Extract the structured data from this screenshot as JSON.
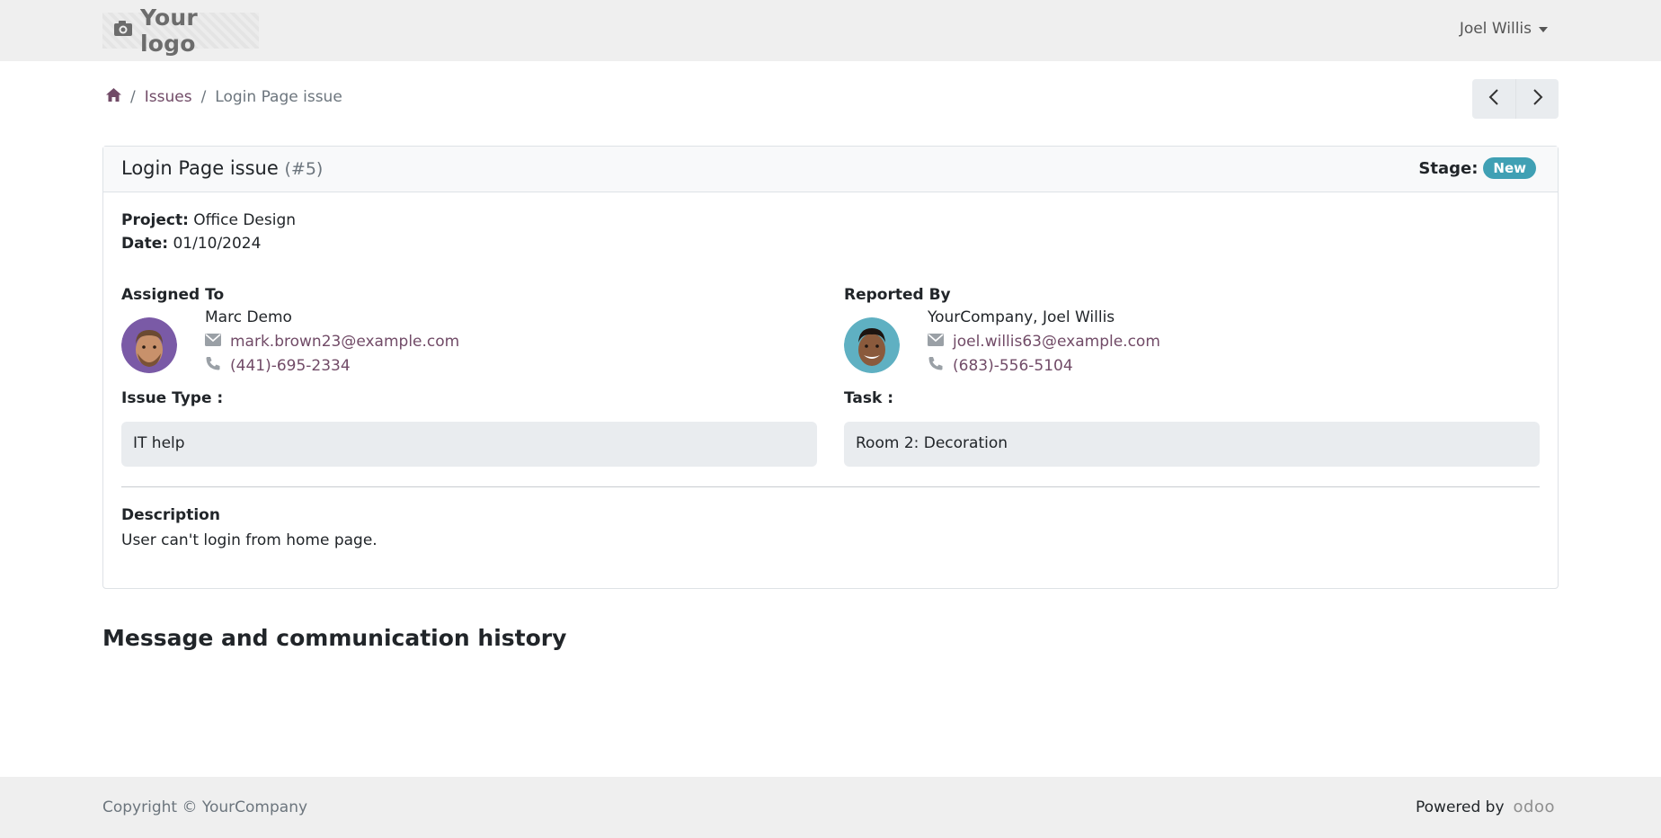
{
  "header": {
    "logo_text": "Your logo",
    "logo_icon": "camera-icon",
    "user_name": "Joel Willis"
  },
  "breadcrumb": {
    "home_icon": "home-icon",
    "items": [
      "Issues",
      "Login Page issue"
    ],
    "separator": "/"
  },
  "pager": {
    "prev_icon": "chevron-left-icon",
    "next_icon": "chevron-right-icon"
  },
  "issue": {
    "title": "Login Page issue",
    "number": "(#5)",
    "stage_label": "Stage:",
    "stage_value": "New",
    "project_label": "Project:",
    "project_value": "Office Design",
    "date_label": "Date:",
    "date_value": "01/10/2024",
    "assigned_label": "Assigned To",
    "assigned": {
      "name": "Marc Demo",
      "email": "mark.brown23@example.com",
      "phone": "(441)-695-2334"
    },
    "reported_label": "Reported By",
    "reported": {
      "name": "YourCompany, Joel Willis",
      "email": "joel.willis63@example.com",
      "phone": "(683)-556-5104"
    },
    "issue_type_label": "Issue Type :",
    "issue_type_value": "IT help",
    "task_label": "Task :",
    "task_value": "Room 2: Decoration",
    "description_label": "Description",
    "description_value": "User can't login from home page."
  },
  "history_title": "Message and communication history",
  "footer": {
    "copyright": "Copyright © YourCompany",
    "powered_by": "Powered by",
    "brand": "odoo"
  },
  "colors": {
    "accent": "#714b67",
    "badge": "#3fa0b4",
    "bar": "#efefef"
  }
}
